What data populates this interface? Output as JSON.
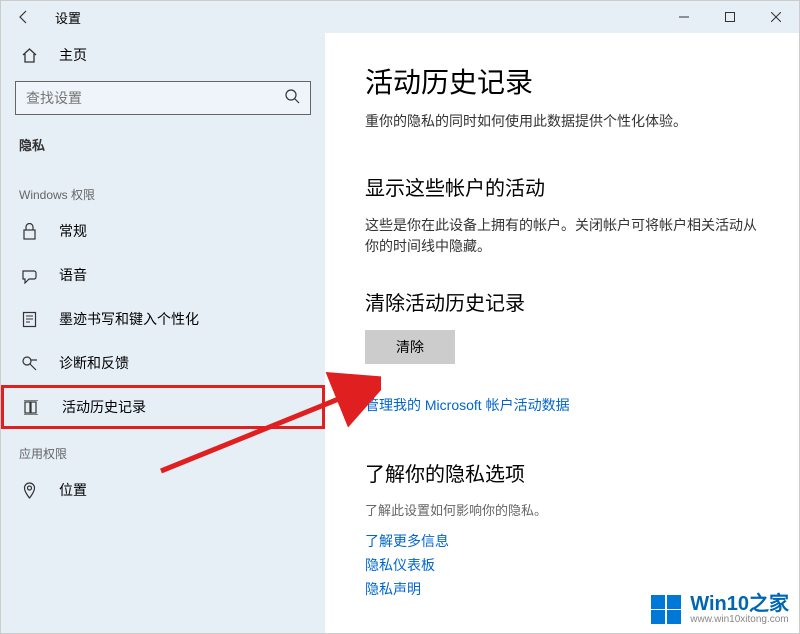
{
  "titlebar": {
    "title": "设置"
  },
  "sidebar": {
    "home": "主页",
    "search_placeholder": "查找设置",
    "section_label": "隐私",
    "subhead1": "Windows 权限",
    "items": [
      {
        "label": "常规"
      },
      {
        "label": "语音"
      },
      {
        "label": "墨迹书写和键入个性化"
      },
      {
        "label": "诊断和反馈"
      },
      {
        "label": "活动历史记录"
      }
    ],
    "subhead2": "应用权限",
    "items2": [
      {
        "label": "位置"
      }
    ]
  },
  "content": {
    "heading": "活动历史记录",
    "truncated_desc": "重你的隐私的同时如何使用此数据提供个性化体验。",
    "section1_title": "显示这些帐户的活动",
    "section1_desc": "这些是你在此设备上拥有的帐户。关闭帐户可将帐户相关活动从你的时间线中隐藏。",
    "section2_title": "清除活动历史记录",
    "clear_button": "清除",
    "manage_link": "管理我的 Microsoft 帐户活动数据",
    "section3_title": "了解你的隐私选项",
    "section3_desc": "了解此设置如何影响你的隐私。",
    "link_more": "了解更多信息",
    "link_dash": "隐私仪表板",
    "link_statement": "隐私声明"
  },
  "watermark": {
    "brand": "Win10之家",
    "url": "www.win10xitong.com"
  }
}
